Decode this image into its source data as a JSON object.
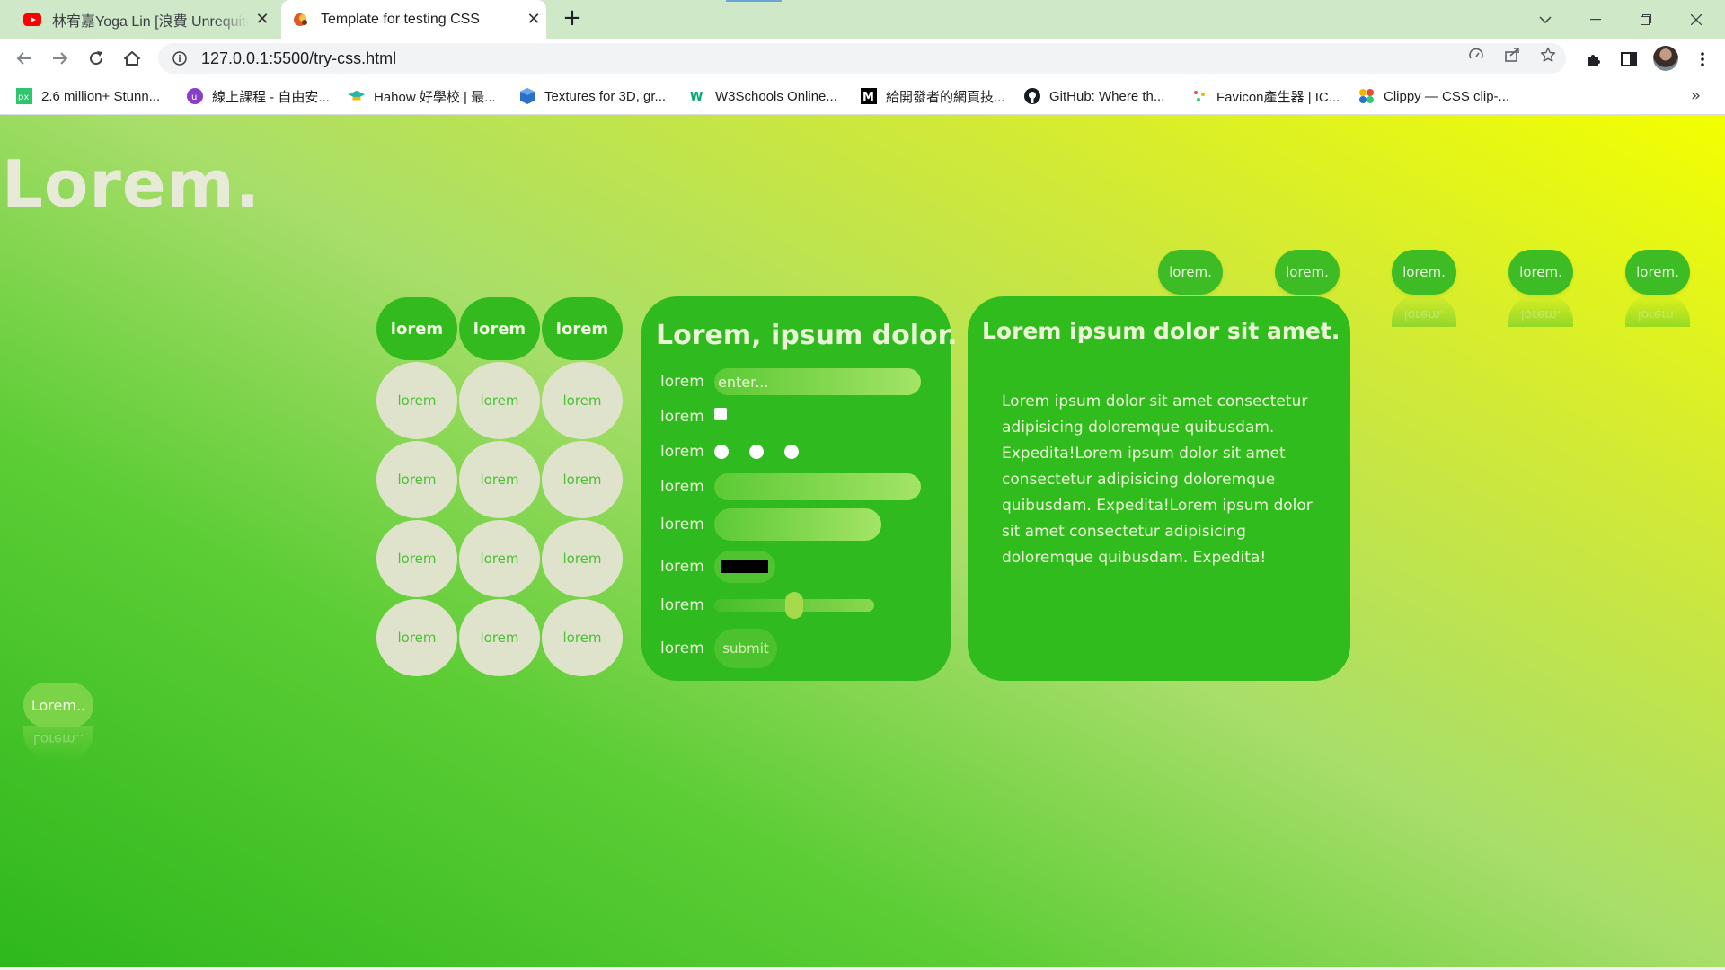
{
  "browser": {
    "tabs": [
      {
        "title": "林宥嘉Yoga Lin [浪費 Unrequited Love]",
        "icon": "youtube-icon",
        "active": false
      },
      {
        "title": "Template for testing CSS",
        "icon": "page-favicon-icon",
        "active": true
      }
    ],
    "new_tab_label": "+",
    "window_controls": [
      "chevron-down-icon",
      "minimize-icon",
      "restore-icon",
      "close-icon"
    ],
    "address": "127.0.0.1:5500/try-css.html",
    "bookmarks": [
      {
        "label": "2.6 million+ Stunn...",
        "icon": "pixabay-icon",
        "color": "#2ec66d"
      },
      {
        "label": "線上課程 - 自由安...",
        "icon": "hahow-u-icon",
        "color": "#8a3ec8"
      },
      {
        "label": "Hahow 好學校 | 最...",
        "icon": "hahow-icon",
        "color": "#22b8a8"
      },
      {
        "label": "Textures for 3D, gr...",
        "icon": "cube-icon",
        "color": "#2a6fc9"
      },
      {
        "label": "W3Schools Online...",
        "icon": "w3schools-icon",
        "color": "#04aa6d"
      },
      {
        "label": "給開發者的網頁技...",
        "icon": "mdn-icon",
        "color": "#000000"
      },
      {
        "label": "GitHub: Where th...",
        "icon": "github-icon",
        "color": "#161b22"
      },
      {
        "label": "Favicon產生器 | IC...",
        "icon": "favicon-icon",
        "color": "#e74c3c"
      },
      {
        "label": "Clippy — CSS clip-...",
        "icon": "clippy-icon",
        "color": "#f4b400"
      }
    ],
    "bookmarks_more": "»"
  },
  "page": {
    "hero_title": "Lorem.",
    "top_pills": [
      "lorem.",
      "lorem.",
      "lorem.",
      "lorem.",
      "lorem."
    ],
    "grid_header_buttons": [
      "lorem",
      "lorem",
      "lorem"
    ],
    "grid_cells": [
      [
        "lorem",
        "lorem",
        "lorem"
      ],
      [
        "lorem",
        "lorem",
        "lorem"
      ],
      [
        "lorem",
        "lorem",
        "lorem"
      ],
      [
        "lorem",
        "lorem",
        "lorem"
      ]
    ],
    "form": {
      "title": "Lorem, ipsum dolor.",
      "text_label": "lorem",
      "text_placeholder": "enter...",
      "checkbox_label": "lorem",
      "radio_label": "lorem",
      "field4_label": "lorem",
      "field5_label": "lorem",
      "color_label": "lorem",
      "color_value": "#000000",
      "range_label": "lorem",
      "range_value": 0.5,
      "submit_label": "lorem",
      "submit_button": "submit"
    },
    "text_card": {
      "title": "Lorem ipsum dolor sit amet.",
      "body": "Lorem ipsum dolor sit amet consectetur adipisicing doloremque quibusdam. Expedita!Lorem ipsum dolor sit amet consectetur adipisicing doloremque quibusdam. Expedita!Lorem ipsum dolor sit amet consectetur adipisicing doloremque quibusdam. Expedita!"
    },
    "corner_button": "Lorem..",
    "colors": {
      "gradient_start": "#2eb81c",
      "gradient_end": "#f3ff00",
      "card_green": "#2fba1f",
      "light_circle": "#e0e3cc"
    }
  }
}
